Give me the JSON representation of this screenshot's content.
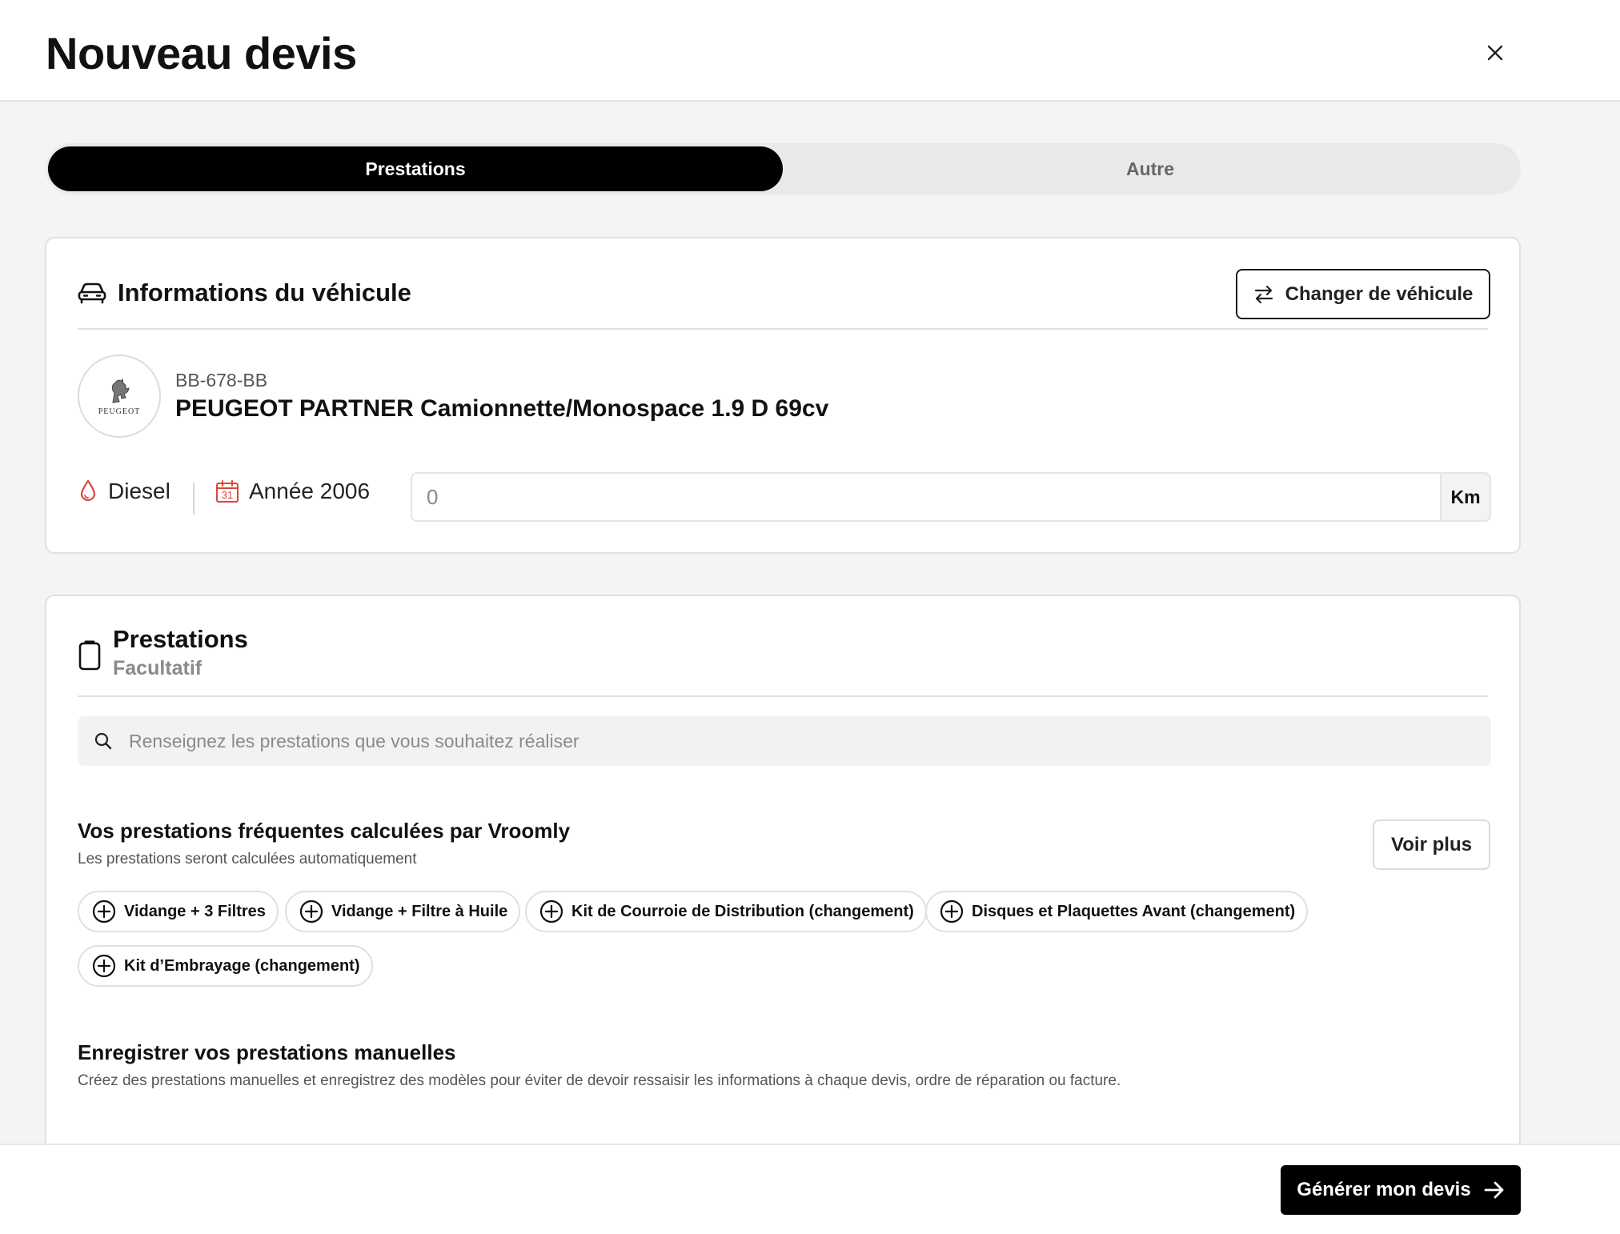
{
  "header": {
    "title": "Nouveau devis",
    "close_icon": "close-icon"
  },
  "tabs": [
    {
      "label": "Prestations",
      "active": true
    },
    {
      "label": "Autre",
      "active": false
    }
  ],
  "vehicle": {
    "section_title": "Informations du véhicule",
    "section_icon": "car-icon",
    "change_button": "Changer de véhicule",
    "change_icon": "swap-arrows-icon",
    "brand_logo_text": "PEUGEOT",
    "plate": "BB-678-BB",
    "model": "PEUGEOT PARTNER Camionnette/Monospace 1.9 D 69cv",
    "fuel": "Diesel",
    "fuel_icon": "fuel-drop-icon",
    "year": "Année 2006",
    "year_icon": "calendar-icon",
    "calendar_day": "31",
    "mileage_placeholder": "0",
    "mileage_unit": "Km"
  },
  "prestations": {
    "section_title": "Prestations",
    "section_subtitle": "Facultatif",
    "section_icon": "clipboard-icon",
    "search_placeholder": "Renseignez les prestations que vous souhaitez réaliser",
    "frequent": {
      "title": "Vos prestations fréquentes calculées par Vroomly",
      "subtitle": "Les prestations seront calculées automatiquement",
      "more_button": "Voir plus",
      "chips": [
        "Vidange + 3 Filtres",
        "Vidange + Filtre à Huile",
        "Kit de Courroie de Distribution (changement)",
        "Disques et Plaquettes Avant (changement)",
        "Kit d’Embrayage (changement)"
      ]
    },
    "manual": {
      "title": "Enregistrer vos prestations manuelles",
      "subtitle": "Créez des prestations manuelles et enregistrez des modèles pour éviter de devoir ressaisir les informations à chaque devis, ordre de réparation ou facture."
    }
  },
  "footer": {
    "generate_button": "Générer mon devis",
    "arrow_icon": "arrow-right-icon"
  },
  "colors": {
    "primary": "#000000",
    "accent_red": "#e0453a",
    "background": "#f4f4f4"
  }
}
